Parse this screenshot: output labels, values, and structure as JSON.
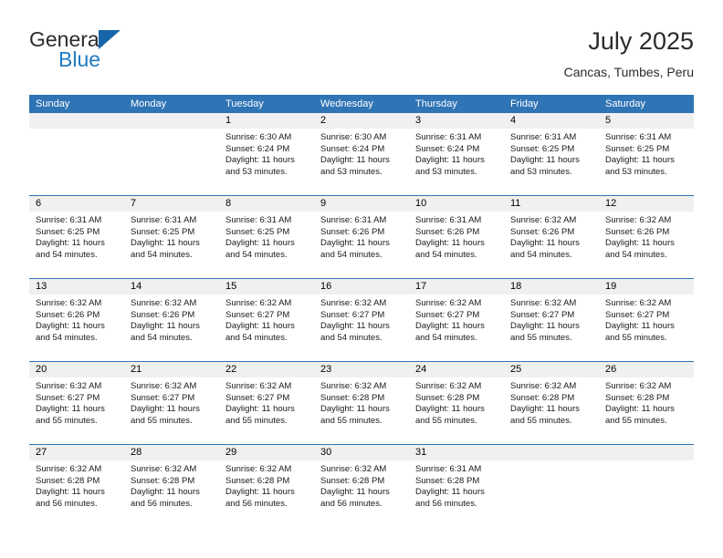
{
  "brand": {
    "name_part1": "General",
    "name_part2": "Blue",
    "accent_color": "#1f7bc1",
    "triangle_color": "#1565a8"
  },
  "header": {
    "month_title": "July 2025",
    "location": "Cancas, Tumbes, Peru"
  },
  "calendar": {
    "header_color": "#2f74b5",
    "day_band_color": "#f0f0f0",
    "weekdays": [
      "Sunday",
      "Monday",
      "Tuesday",
      "Wednesday",
      "Thursday",
      "Friday",
      "Saturday"
    ],
    "weeks": [
      [
        {
          "day": "",
          "empty": true
        },
        {
          "day": "",
          "empty": true
        },
        {
          "day": "1",
          "sunrise": "Sunrise: 6:30 AM",
          "sunset": "Sunset: 6:24 PM",
          "daylight": "Daylight: 11 hours and 53 minutes."
        },
        {
          "day": "2",
          "sunrise": "Sunrise: 6:30 AM",
          "sunset": "Sunset: 6:24 PM",
          "daylight": "Daylight: 11 hours and 53 minutes."
        },
        {
          "day": "3",
          "sunrise": "Sunrise: 6:31 AM",
          "sunset": "Sunset: 6:24 PM",
          "daylight": "Daylight: 11 hours and 53 minutes."
        },
        {
          "day": "4",
          "sunrise": "Sunrise: 6:31 AM",
          "sunset": "Sunset: 6:25 PM",
          "daylight": "Daylight: 11 hours and 53 minutes."
        },
        {
          "day": "5",
          "sunrise": "Sunrise: 6:31 AM",
          "sunset": "Sunset: 6:25 PM",
          "daylight": "Daylight: 11 hours and 53 minutes."
        }
      ],
      [
        {
          "day": "6",
          "sunrise": "Sunrise: 6:31 AM",
          "sunset": "Sunset: 6:25 PM",
          "daylight": "Daylight: 11 hours and 54 minutes."
        },
        {
          "day": "7",
          "sunrise": "Sunrise: 6:31 AM",
          "sunset": "Sunset: 6:25 PM",
          "daylight": "Daylight: 11 hours and 54 minutes."
        },
        {
          "day": "8",
          "sunrise": "Sunrise: 6:31 AM",
          "sunset": "Sunset: 6:25 PM",
          "daylight": "Daylight: 11 hours and 54 minutes."
        },
        {
          "day": "9",
          "sunrise": "Sunrise: 6:31 AM",
          "sunset": "Sunset: 6:26 PM",
          "daylight": "Daylight: 11 hours and 54 minutes."
        },
        {
          "day": "10",
          "sunrise": "Sunrise: 6:31 AM",
          "sunset": "Sunset: 6:26 PM",
          "daylight": "Daylight: 11 hours and 54 minutes."
        },
        {
          "day": "11",
          "sunrise": "Sunrise: 6:32 AM",
          "sunset": "Sunset: 6:26 PM",
          "daylight": "Daylight: 11 hours and 54 minutes."
        },
        {
          "day": "12",
          "sunrise": "Sunrise: 6:32 AM",
          "sunset": "Sunset: 6:26 PM",
          "daylight": "Daylight: 11 hours and 54 minutes."
        }
      ],
      [
        {
          "day": "13",
          "sunrise": "Sunrise: 6:32 AM",
          "sunset": "Sunset: 6:26 PM",
          "daylight": "Daylight: 11 hours and 54 minutes."
        },
        {
          "day": "14",
          "sunrise": "Sunrise: 6:32 AM",
          "sunset": "Sunset: 6:26 PM",
          "daylight": "Daylight: 11 hours and 54 minutes."
        },
        {
          "day": "15",
          "sunrise": "Sunrise: 6:32 AM",
          "sunset": "Sunset: 6:27 PM",
          "daylight": "Daylight: 11 hours and 54 minutes."
        },
        {
          "day": "16",
          "sunrise": "Sunrise: 6:32 AM",
          "sunset": "Sunset: 6:27 PM",
          "daylight": "Daylight: 11 hours and 54 minutes."
        },
        {
          "day": "17",
          "sunrise": "Sunrise: 6:32 AM",
          "sunset": "Sunset: 6:27 PM",
          "daylight": "Daylight: 11 hours and 54 minutes."
        },
        {
          "day": "18",
          "sunrise": "Sunrise: 6:32 AM",
          "sunset": "Sunset: 6:27 PM",
          "daylight": "Daylight: 11 hours and 55 minutes."
        },
        {
          "day": "19",
          "sunrise": "Sunrise: 6:32 AM",
          "sunset": "Sunset: 6:27 PM",
          "daylight": "Daylight: 11 hours and 55 minutes."
        }
      ],
      [
        {
          "day": "20",
          "sunrise": "Sunrise: 6:32 AM",
          "sunset": "Sunset: 6:27 PM",
          "daylight": "Daylight: 11 hours and 55 minutes."
        },
        {
          "day": "21",
          "sunrise": "Sunrise: 6:32 AM",
          "sunset": "Sunset: 6:27 PM",
          "daylight": "Daylight: 11 hours and 55 minutes."
        },
        {
          "day": "22",
          "sunrise": "Sunrise: 6:32 AM",
          "sunset": "Sunset: 6:27 PM",
          "daylight": "Daylight: 11 hours and 55 minutes."
        },
        {
          "day": "23",
          "sunrise": "Sunrise: 6:32 AM",
          "sunset": "Sunset: 6:28 PM",
          "daylight": "Daylight: 11 hours and 55 minutes."
        },
        {
          "day": "24",
          "sunrise": "Sunrise: 6:32 AM",
          "sunset": "Sunset: 6:28 PM",
          "daylight": "Daylight: 11 hours and 55 minutes."
        },
        {
          "day": "25",
          "sunrise": "Sunrise: 6:32 AM",
          "sunset": "Sunset: 6:28 PM",
          "daylight": "Daylight: 11 hours and 55 minutes."
        },
        {
          "day": "26",
          "sunrise": "Sunrise: 6:32 AM",
          "sunset": "Sunset: 6:28 PM",
          "daylight": "Daylight: 11 hours and 55 minutes."
        }
      ],
      [
        {
          "day": "27",
          "sunrise": "Sunrise: 6:32 AM",
          "sunset": "Sunset: 6:28 PM",
          "daylight": "Daylight: 11 hours and 56 minutes."
        },
        {
          "day": "28",
          "sunrise": "Sunrise: 6:32 AM",
          "sunset": "Sunset: 6:28 PM",
          "daylight": "Daylight: 11 hours and 56 minutes."
        },
        {
          "day": "29",
          "sunrise": "Sunrise: 6:32 AM",
          "sunset": "Sunset: 6:28 PM",
          "daylight": "Daylight: 11 hours and 56 minutes."
        },
        {
          "day": "30",
          "sunrise": "Sunrise: 6:32 AM",
          "sunset": "Sunset: 6:28 PM",
          "daylight": "Daylight: 11 hours and 56 minutes."
        },
        {
          "day": "31",
          "sunrise": "Sunrise: 6:31 AM",
          "sunset": "Sunset: 6:28 PM",
          "daylight": "Daylight: 11 hours and 56 minutes."
        },
        {
          "day": "",
          "empty": true
        },
        {
          "day": "",
          "empty": true
        }
      ]
    ]
  }
}
